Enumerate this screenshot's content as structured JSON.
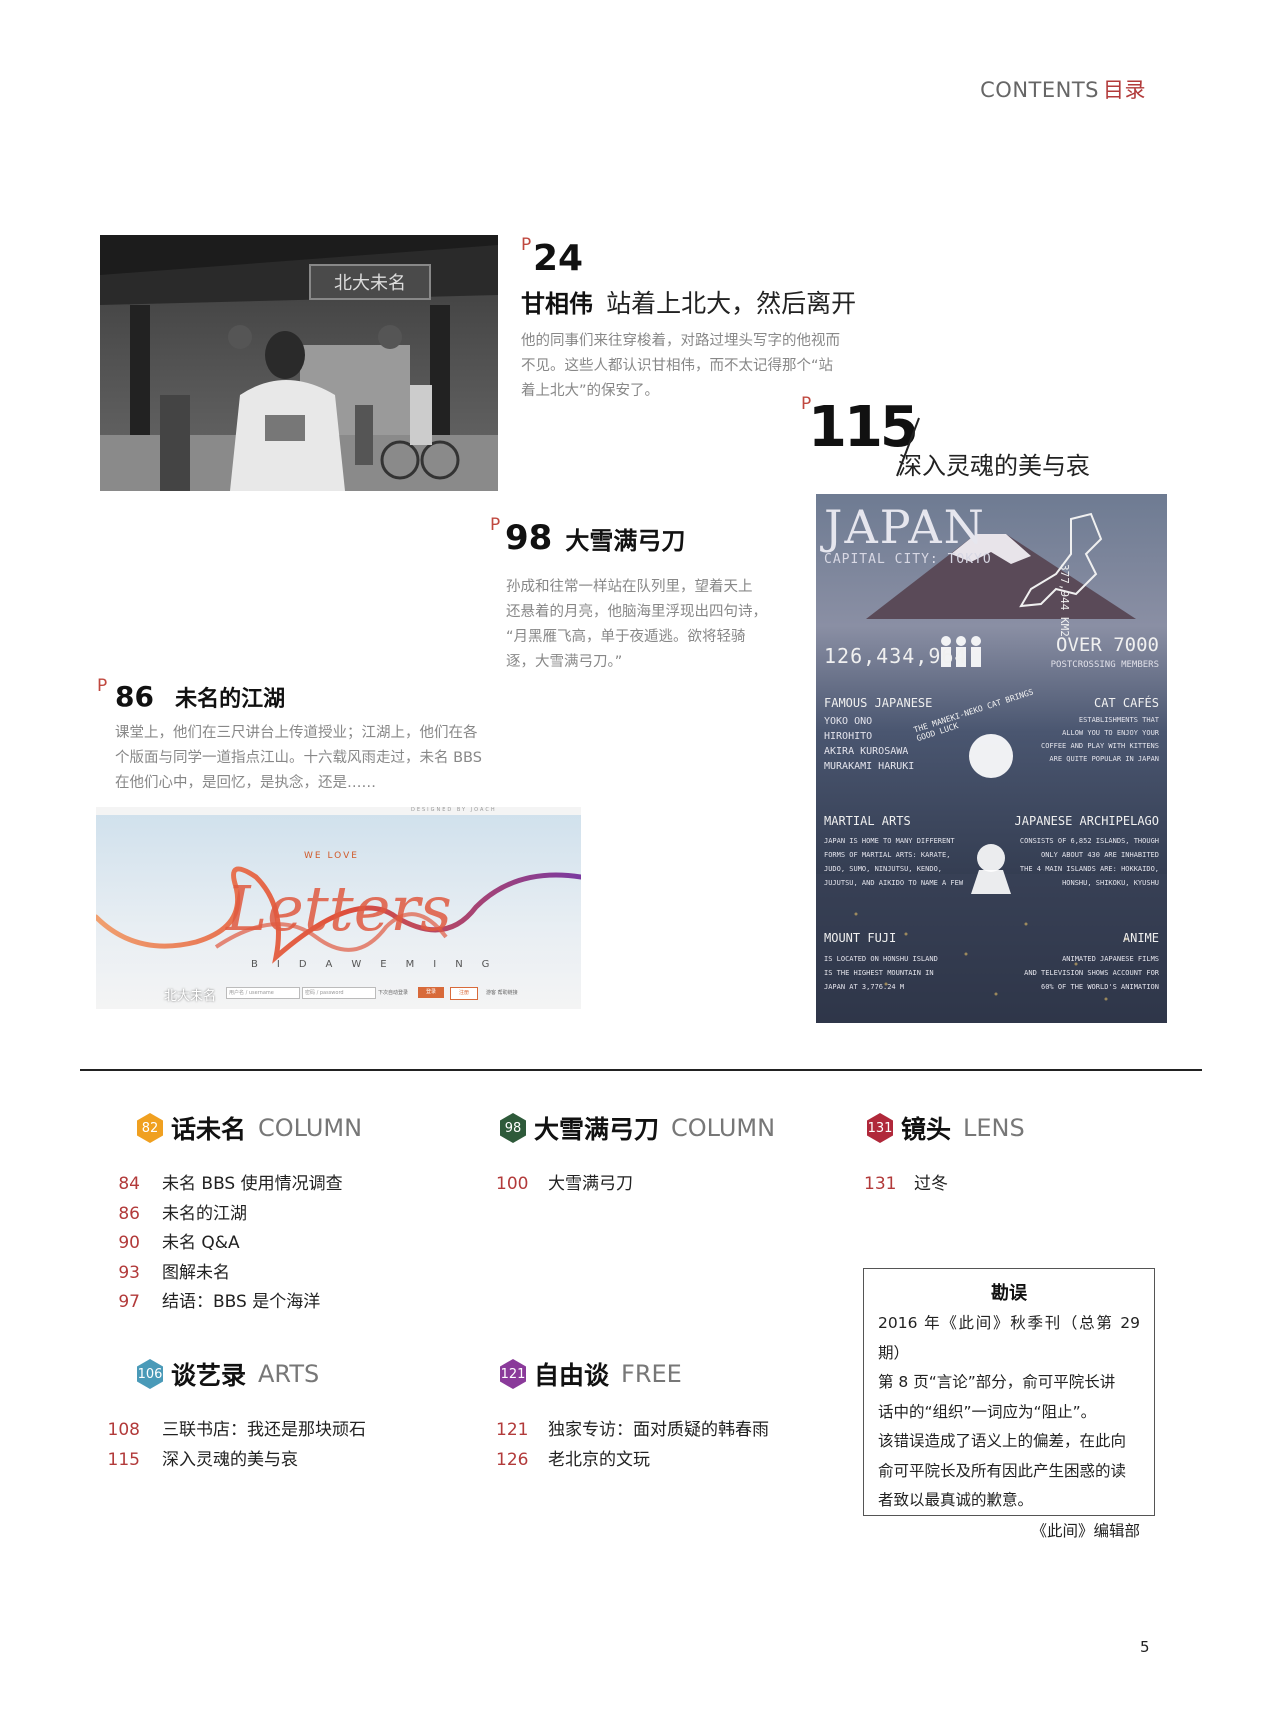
{
  "header": {
    "contents": "CONTENTS",
    "cn": "目录"
  },
  "features": {
    "p24": {
      "p": "P",
      "num": "24",
      "person": "甘相伟",
      "title": "站着上北大，然后离开",
      "desc": [
        "他的同事们来往穿梭着，对路过埋头写字的他视而",
        "不见。这些人都认识甘相伟，而不太记得那个“站",
        "着上北大”的保安了。"
      ],
      "image_text": "北大未名"
    },
    "p98": {
      "p": "P",
      "num": "98",
      "title": "大雪满弓刀",
      "desc": [
        "孙成和往常一样站在队列里，望着天上",
        "还悬着的月亮，他脑海里浮现出四句诗，",
        "“月黑雁飞高，单于夜遁逃。欲将轻骑",
        "逐，大雪满弓刀。”"
      ]
    },
    "p86": {
      "p": "P",
      "num": "86",
      "title": "未名的江湖",
      "desc": [
        "课堂上，他们在三尺讲台上传道授业；江湖上，他们在各",
        "个版面与同学一道指点江山。十六载风雨走过，未名 BBS",
        "在他们心中，是回忆，是执念，还是……"
      ],
      "bbs": {
        "designed": "DESIGNED BY JOACH",
        "we_love": "WE LOVE",
        "script": "Letters",
        "letters": [
          "B",
          "I",
          "D",
          "A",
          "W",
          "E",
          "M",
          "I",
          "N",
          "G"
        ],
        "site": "北大未名",
        "user_ph": "用户名 / username",
        "pass_ph": "密码 / password",
        "remember": "下次自动登录",
        "login": "登录",
        "register": "注册",
        "extra": "游客 帮助链接"
      }
    },
    "p115": {
      "p": "P",
      "num": "115",
      "title": "深入灵魂的美与哀",
      "poster": {
        "title": "JAPAN",
        "capital": "CAPITAL CITY: TOKYO",
        "area": "377,944 KM2",
        "population": "126,434,964",
        "over": "OVER 7000",
        "postcrossing": "POSTCROSSING MEMBERS",
        "famous_title": "FAMOUS JAPANESE",
        "famous": [
          "YOKO ONO",
          "HIROHITO",
          "AKIRA KUROSAWA",
          "MURAKAMI HARUKI"
        ],
        "maneki": "THE MANEKI-NEKO CAT BRINGS GOOD LUCK",
        "cat_title": "CAT CAFÉS",
        "cat": [
          "ESTABLISHMENTS THAT",
          "ALLOW YOU TO ENJOY YOUR",
          "COFFEE AND PLAY WITH KITTENS",
          "ARE QUITE POPULAR IN JAPAN"
        ],
        "martial_title": "MARTIAL ARTS",
        "martial": [
          "JAPAN IS HOME TO MANY DIFFERENT",
          "FORMS OF MARTIAL ARTS: KARATE,",
          "JUDO, SUMO, NINJUTSU, KENDO,",
          "JUJUTSU, AND AIKIDO TO NAME A FEW"
        ],
        "arch_title": "JAPANESE ARCHIPELAGO",
        "arch": [
          "CONSISTS OF 6,852 ISLANDS, THOUGH",
          "ONLY ABOUT 430 ARE INHABITED",
          "THE 4 MAIN ISLANDS ARE: HOKKAIDO,",
          "HONSHU, SHIKOKU, KYUSHU"
        ],
        "fuji_title": "MOUNT FUJI",
        "fuji": [
          "IS LOCATED ON HONSHU ISLAND",
          "IS THE HIGHEST MOUNTAIN IN",
          "JAPAN AT 3,776.24 M"
        ],
        "anime_title": "ANIME",
        "anime": [
          "ANIMATED JAPANESE FILMS",
          "AND TELEVISION SHOWS ACCOUNT FOR",
          "60% OF THE WORLD'S ANIMATION"
        ]
      }
    }
  },
  "sections": {
    "hua": {
      "badge": "82",
      "cn": "话未名",
      "en": "COLUMN",
      "color": "#f0a020",
      "items": [
        {
          "num": "84",
          "title": "未名 BBS 使用情况调查"
        },
        {
          "num": "86",
          "title": "未名的江湖"
        },
        {
          "num": "90",
          "title": "未名 Q&A"
        },
        {
          "num": "93",
          "title": "图解未名"
        },
        {
          "num": "97",
          "title": "结语：BBS 是个海洋"
        }
      ]
    },
    "dxm": {
      "badge": "98",
      "cn": "大雪满弓刀",
      "en": "COLUMN",
      "color": "#2e5a3a",
      "items": [
        {
          "num": "100",
          "title": "大雪满弓刀"
        }
      ]
    },
    "lens": {
      "badge": "131",
      "cn": "镜头",
      "en": "LENS",
      "color": "#b0283a",
      "items": [
        {
          "num": "131",
          "title": "过冬"
        }
      ]
    },
    "arts": {
      "badge": "106",
      "cn": "谈艺录",
      "en": "ARTS",
      "color": "#4a9ab8",
      "items": [
        {
          "num": "108",
          "title": "三联书店：我还是那块顽石"
        },
        {
          "num": "115",
          "title": "深入灵魂的美与哀"
        }
      ]
    },
    "free": {
      "badge": "121",
      "cn": "自由谈",
      "en": "FREE",
      "color": "#8a3a9a",
      "items": [
        {
          "num": "121",
          "title": "独家专访：面对质疑的韩春雨"
        },
        {
          "num": "126",
          "title": "老北京的文玩"
        }
      ]
    }
  },
  "errata": {
    "title": "勘误",
    "lines": [
      "2016 年《此间》秋季刊（总第 29 期）",
      "第 8 页“言论”部分，俞可平院长讲",
      "话中的“组织”一词应为“阻止”。",
      "该错误造成了语义上的偏差，在此向",
      "俞可平院长及所有因此产生困惑的读",
      "者致以最真诚的歉意。"
    ],
    "sign": "《此间》编辑部"
  },
  "page_number": "5"
}
